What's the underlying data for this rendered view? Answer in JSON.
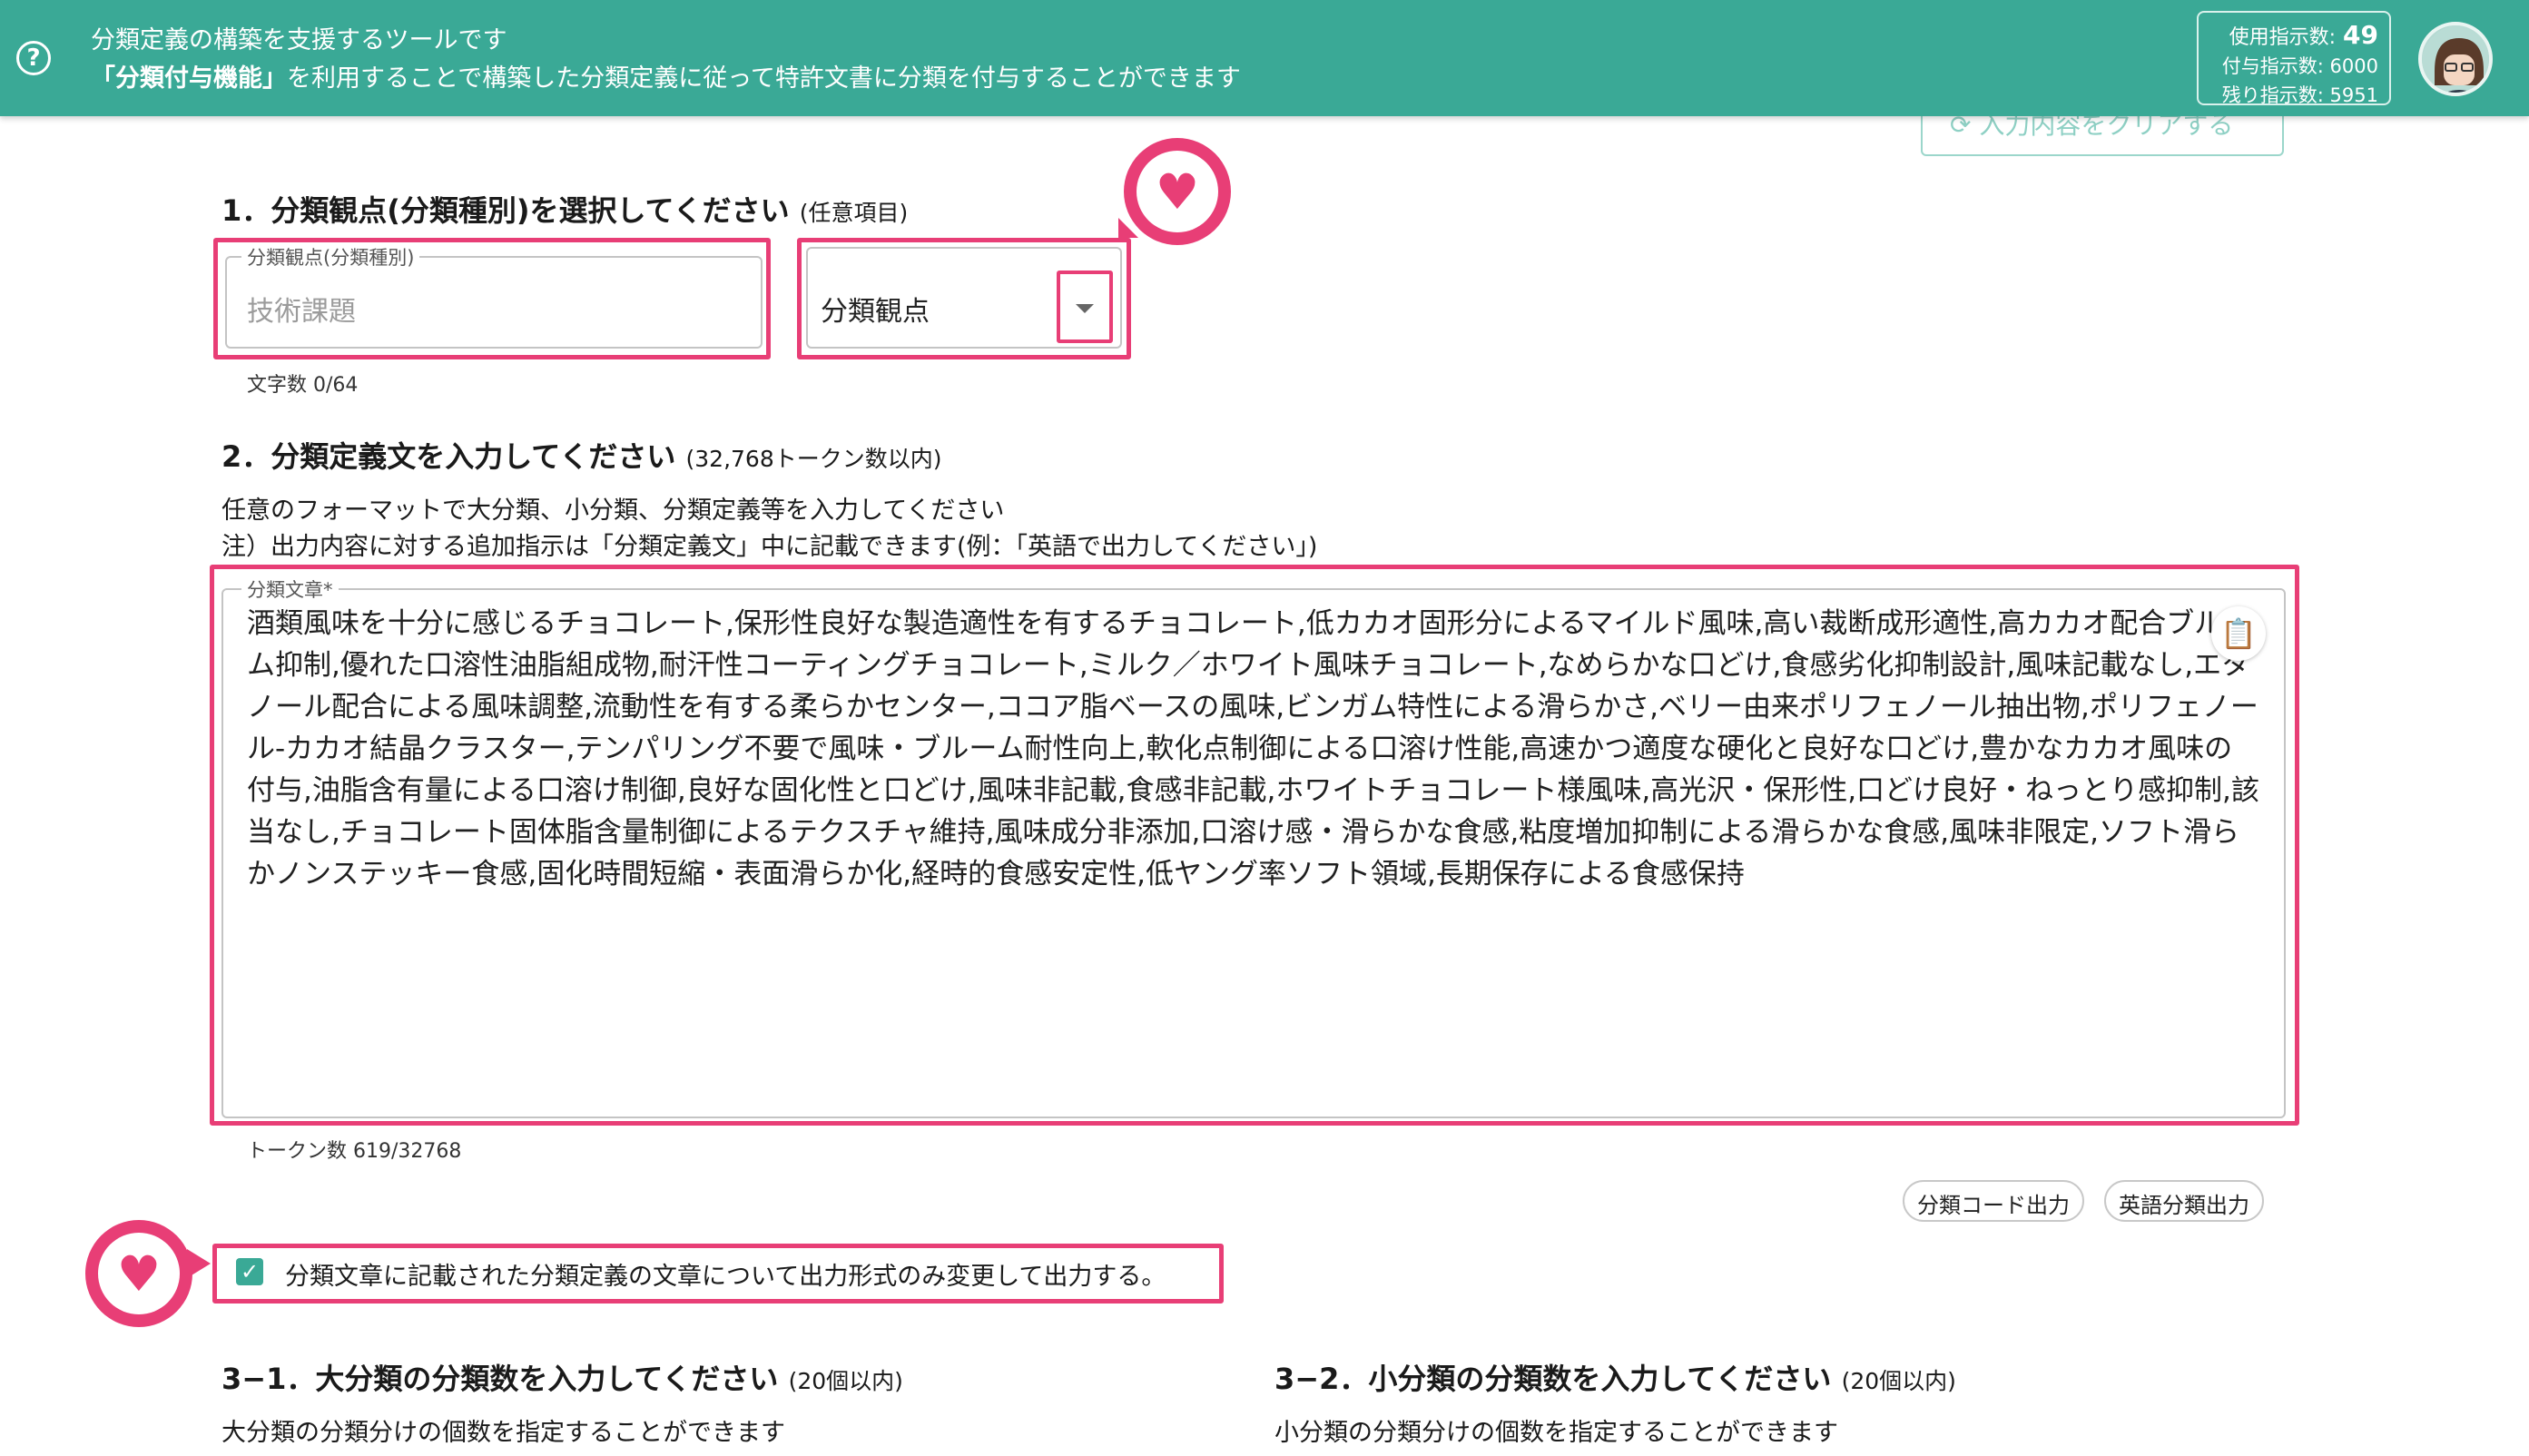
{
  "header": {
    "help_icon": "help-circle-icon",
    "line1": "分類定義の構築を支援するツールです",
    "line2_bold": "「分類付与機能」",
    "line2_rest": "を利用することで構築した分類定義に従って特許文書に分類を付与することができます",
    "used_label": "使用指示数:",
    "used_value": "49",
    "granted": "付与指示数: 6000",
    "remaining": "残り指示数: 5951",
    "avatar_icon": "user-avatar-icon"
  },
  "clear_button": "入力内容をクリアする",
  "section1": {
    "title": "1．分類観点(分類種別)を選択してください",
    "note": "(任意項目)",
    "field_label": "分類観点(分類種別)",
    "field_placeholder": "技術課題",
    "select_value": "分類観点",
    "char_count": "文字数 0/64"
  },
  "section2": {
    "title": "2．分類定義文を入力してください",
    "note": "(32,768トークン数以内)",
    "desc1": "任意のフォーマットで大分類、小分類、分類定義等を入力してください",
    "desc2": "注）出力内容に対する追加指示は「分類定義文」中に記載できます(例：「英語で出力してください」)",
    "field_label": "分類文章*",
    "text": "酒類風味を十分に感じるチョコレート,保形性良好な製造適性を有するチョコレート,低カカオ固形分によるマイルド風味,高い裁断成形適性,高カカオ配合ブルーム抑制,優れた口溶性油脂組成物,耐汗性コーティングチョコレート,ミルク／ホワイト風味チョコレート,なめらかな口どけ,食感劣化抑制設計,風味記載なし,エタノール配合による風味調整,流動性を有する柔らかセンター,ココア脂ベースの風味,ビンガム特性による滑らかさ,ベリー由来ポリフェノール抽出物,ポリフェノール-カカオ結晶クラスター,テンパリング不要で風味・ブルーム耐性向上,軟化点制御による口溶け性能,高速かつ適度な硬化と良好な口どけ,豊かなカカオ風味の付与,油脂含有量による口溶け制御,良好な固化性と口どけ,風味非記載,食感非記載,ホワイトチョコレート様風味,高光沢・保形性,口どけ良好・ねっとり感抑制,該当なし,チョコレート固体脂含量制御によるテクスチャ維持,風味成分非添加,口溶け感・滑らかな食感,粘度増加抑制による滑らかな食感,風味非限定,ソフト滑らかノンステッキー食感,固化時間短縮・表面滑らか化,経時的食感安定性,低ヤング率ソフト領域,長期保存による食感保持",
    "token_count": "トークン数 619/32768",
    "clipboard_icon": "clipboard-icon",
    "chip_code": "分類コード出力",
    "chip_english": "英語分類出力",
    "checkbox_label": "分類文章に記載された分類定義の文章について出力形式のみ変更して出力する。"
  },
  "section31": {
    "title": "3−1．大分類の分類数を入力してください",
    "note": "(20個以内)",
    "desc": "大分類の分類分けの個数を指定することができます"
  },
  "section32": {
    "title": "3−2．小分類の分類数を入力してください",
    "note": "(20個以内)",
    "desc": "小分類の分類分けの個数を指定することができます"
  },
  "colors": {
    "header": "#3aa996",
    "highlight": "#e83e76"
  }
}
